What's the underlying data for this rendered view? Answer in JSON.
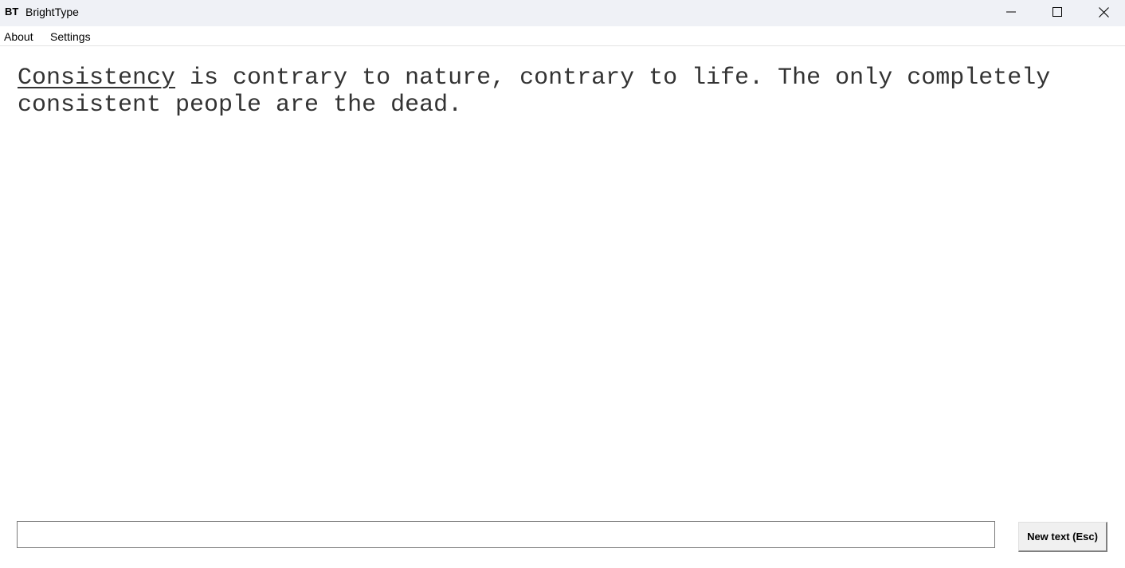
{
  "window": {
    "icon_text": "BT",
    "title": "BrightType",
    "icons": {
      "minimize": "minimize-icon",
      "maximize": "maximize-icon",
      "close": "close-icon"
    }
  },
  "menu": {
    "items": [
      {
        "label": "About"
      },
      {
        "label": "Settings"
      }
    ]
  },
  "text": {
    "current_word": "Consistency",
    "remaining": " is contrary to nature, contrary to life. The only completely\nconsistent people are the dead."
  },
  "input": {
    "value": "",
    "placeholder": ""
  },
  "buttons": {
    "new_text": "New text (Esc)"
  },
  "colors": {
    "titlebar_bg": "#eff1f6",
    "text_color": "#333333"
  }
}
